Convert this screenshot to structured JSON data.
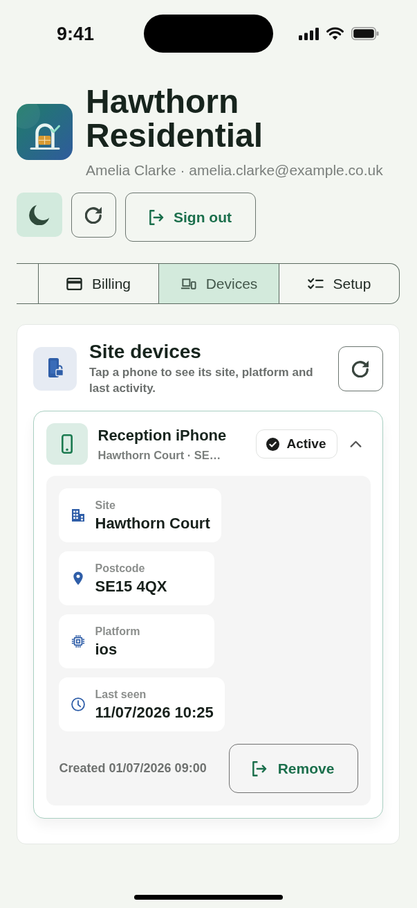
{
  "status_bar": {
    "time": "9:41"
  },
  "header": {
    "title": "Hawthorn Residential",
    "subtitle": "Amelia Clarke · amelia.clarke@example.co.uk"
  },
  "toolbar": [
    {
      "kind": "theme"
    },
    {
      "kind": "refresh"
    },
    {
      "kind": "sign_out",
      "label": "Sign out"
    }
  ],
  "tabs": [
    {
      "label": "Billing",
      "selected": false
    },
    {
      "label": "Devices",
      "selected": true
    },
    {
      "label": "Setup",
      "selected": false
    }
  ],
  "devices_panel": {
    "title": "Site devices",
    "description": "Tap a phone to see its site, platform and last activity.",
    "devices": [
      {
        "name": "Reception iPhone",
        "summary": "Hawthorn Court · SE…",
        "status": "Active",
        "expanded": true,
        "details": [
          {
            "kind": "site",
            "label": "Site",
            "value": "Hawthorn Court"
          },
          {
            "kind": "postcode",
            "label": "Postcode",
            "value": "SE15 4QX"
          },
          {
            "kind": "platform",
            "label": "Platform",
            "value": "ios"
          },
          {
            "kind": "last_seen",
            "label": "Last seen",
            "value": "11/07/2026 10:25"
          }
        ],
        "created": "Created 01/07/2026 09:00",
        "remove_label": "Remove"
      }
    ]
  }
}
